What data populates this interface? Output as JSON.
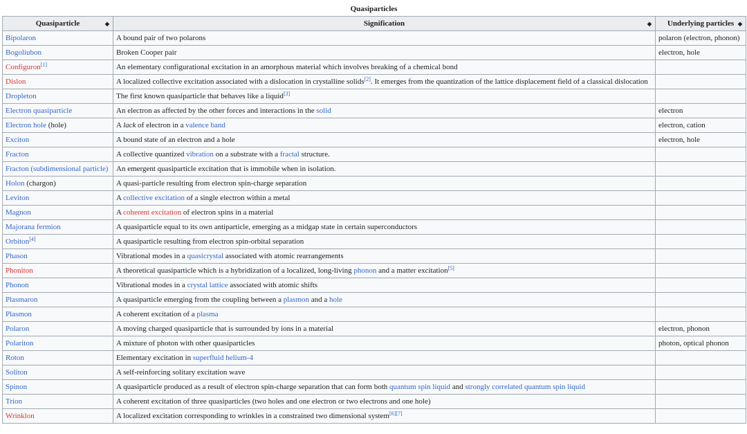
{
  "table": {
    "caption": "Quasiparticles",
    "headers": [
      "Quasiparticle",
      "Signification",
      "Underlying particles"
    ],
    "sort_icon": "sort-arrows-icon",
    "colors": {
      "link": "#3366cc",
      "redlink": "#dd3333",
      "border": "#a2a9b1",
      "header_bg": "#eaecf0"
    },
    "rows": [
      {
        "name": [
          {
            "t": "Bipolaron",
            "k": "link"
          }
        ],
        "sig": [
          {
            "t": "A bound pair of two polarons"
          }
        ],
        "under": "polaron (electron, phonon)"
      },
      {
        "name": [
          {
            "t": "Bogoliubon",
            "k": "link"
          }
        ],
        "sig": [
          {
            "t": "Broken Cooper pair"
          }
        ],
        "under": "electron, hole"
      },
      {
        "name": [
          {
            "t": "Configuron",
            "k": "new"
          },
          {
            "t": "[1]",
            "k": "sup"
          }
        ],
        "sig": [
          {
            "t": "An elementary configurational excitation in an amorphous material which involves breaking of a chemical bond"
          }
        ],
        "under": ""
      },
      {
        "name": [
          {
            "t": "Dislon",
            "k": "new"
          }
        ],
        "sig": [
          {
            "t": "A localized collective excitation associated with a dislocation in crystalline solids"
          },
          {
            "t": "[2]",
            "k": "sup"
          },
          {
            "t": ". It emerges from the quantization of the lattice displacement field of a classical dislocation"
          }
        ],
        "under": ""
      },
      {
        "name": [
          {
            "t": "Dropleton",
            "k": "link"
          }
        ],
        "sig": [
          {
            "t": "The first known quasiparticle that behaves like a liquid"
          },
          {
            "t": "[3]",
            "k": "sup"
          }
        ],
        "under": ""
      },
      {
        "name": [
          {
            "t": "Electron quasiparticle",
            "k": "link"
          }
        ],
        "sig": [
          {
            "t": "An electron as affected by the other forces and interactions in the "
          },
          {
            "t": "solid",
            "k": "link"
          }
        ],
        "under": "electron"
      },
      {
        "name": [
          {
            "t": "Electron hole",
            "k": "link"
          },
          {
            "t": " (hole)"
          }
        ],
        "sig": [
          {
            "t": "A "
          },
          {
            "t": "lack",
            "k": "i"
          },
          {
            "t": " of electron in a "
          },
          {
            "t": "valence band",
            "k": "link"
          }
        ],
        "under": "electron, cation"
      },
      {
        "name": [
          {
            "t": "Exciton",
            "k": "link"
          }
        ],
        "sig": [
          {
            "t": "A bound state of an electron and a hole"
          }
        ],
        "under": "electron, hole"
      },
      {
        "name": [
          {
            "t": "Fracton",
            "k": "link"
          }
        ],
        "sig": [
          {
            "t": "A collective quantized "
          },
          {
            "t": "vibration",
            "k": "link"
          },
          {
            "t": " on a substrate with a "
          },
          {
            "t": "fractal",
            "k": "link"
          },
          {
            "t": " structure."
          }
        ],
        "under": ""
      },
      {
        "name": [
          {
            "t": "Fracton (subdimensional particle)",
            "k": "link"
          }
        ],
        "sig": [
          {
            "t": "An emergent quasiparticle excitation that is immobile when in isolation."
          }
        ],
        "under": ""
      },
      {
        "name": [
          {
            "t": "Holon",
            "k": "link"
          },
          {
            "t": " (chargon)"
          }
        ],
        "sig": [
          {
            "t": "A quasi-particle resulting from electron spin-charge separation"
          }
        ],
        "under": ""
      },
      {
        "name": [
          {
            "t": "Leviton",
            "k": "link"
          }
        ],
        "sig": [
          {
            "t": "A "
          },
          {
            "t": "collective excitation",
            "k": "link"
          },
          {
            "t": " of a single electron within a metal"
          }
        ],
        "under": ""
      },
      {
        "name": [
          {
            "t": "Magnon",
            "k": "link"
          }
        ],
        "sig": [
          {
            "t": "A "
          },
          {
            "t": "coherent excitation",
            "k": "new"
          },
          {
            "t": " of electron spins in a material"
          }
        ],
        "under": ""
      },
      {
        "name": [
          {
            "t": "Majorana fermion",
            "k": "link"
          }
        ],
        "sig": [
          {
            "t": "A quasiparticle equal to its own antiparticle, emerging as a midgap state in certain superconductors"
          }
        ],
        "under": ""
      },
      {
        "name": [
          {
            "t": "Orbiton",
            "k": "link"
          },
          {
            "t": "[4]",
            "k": "sup"
          }
        ],
        "sig": [
          {
            "t": "A quasiparticle resulting from electron spin-orbital separation"
          }
        ],
        "under": ""
      },
      {
        "name": [
          {
            "t": "Phason",
            "k": "link"
          }
        ],
        "sig": [
          {
            "t": "Vibrational modes in a "
          },
          {
            "t": "quasicrystal",
            "k": "link"
          },
          {
            "t": " associated with atomic rearrangements"
          }
        ],
        "under": ""
      },
      {
        "name": [
          {
            "t": "Phoniton",
            "k": "new"
          }
        ],
        "sig": [
          {
            "t": "A theoretical quasiparticle which is a hybridization of a localized, long-living "
          },
          {
            "t": "phonon",
            "k": "link"
          },
          {
            "t": " and a matter excitation"
          },
          {
            "t": "[5]",
            "k": "sup"
          }
        ],
        "under": ""
      },
      {
        "name": [
          {
            "t": "Phonon",
            "k": "link"
          }
        ],
        "sig": [
          {
            "t": "Vibrational modes in a "
          },
          {
            "t": "crystal lattice",
            "k": "link"
          },
          {
            "t": " associated with atomic shifts"
          }
        ],
        "under": ""
      },
      {
        "name": [
          {
            "t": "Plasmaron",
            "k": "link"
          }
        ],
        "sig": [
          {
            "t": "A quasiparticle emerging from the coupling between a "
          },
          {
            "t": "plasmon",
            "k": "link"
          },
          {
            "t": " and a "
          },
          {
            "t": "hole",
            "k": "link"
          }
        ],
        "under": ""
      },
      {
        "name": [
          {
            "t": "Plasmon",
            "k": "link"
          }
        ],
        "sig": [
          {
            "t": "A coherent excitation of a "
          },
          {
            "t": "plasma",
            "k": "link"
          }
        ],
        "under": ""
      },
      {
        "name": [
          {
            "t": "Polaron",
            "k": "link"
          }
        ],
        "sig": [
          {
            "t": "A moving charged quasiparticle that is surrounded by ions in a material"
          }
        ],
        "under": "electron, phonon"
      },
      {
        "name": [
          {
            "t": "Polariton",
            "k": "link"
          }
        ],
        "sig": [
          {
            "t": "A mixture of photon with other quasiparticles"
          }
        ],
        "under": "photon, optical phonon"
      },
      {
        "name": [
          {
            "t": "Roton",
            "k": "link"
          }
        ],
        "sig": [
          {
            "t": "Elementary excitation in "
          },
          {
            "t": "superfluid helium-4",
            "k": "link"
          }
        ],
        "under": ""
      },
      {
        "name": [
          {
            "t": "Soliton",
            "k": "link"
          }
        ],
        "sig": [
          {
            "t": "A self-reinforcing solitary excitation wave"
          }
        ],
        "under": ""
      },
      {
        "name": [
          {
            "t": "Spinon",
            "k": "link"
          }
        ],
        "sig": [
          {
            "t": "A quasiparticle produced as a result of electron spin-charge separation that can form both "
          },
          {
            "t": "quantum spin liquid",
            "k": "link"
          },
          {
            "t": " and "
          },
          {
            "t": "strongly correlated quantum spin liquid",
            "k": "link"
          }
        ],
        "under": ""
      },
      {
        "name": [
          {
            "t": "Trion",
            "k": "link"
          }
        ],
        "sig": [
          {
            "t": "A coherent excitation of three quasiparticles (two holes and one electron or two electrons and one hole)"
          }
        ],
        "under": ""
      },
      {
        "name": [
          {
            "t": "Wrinklon",
            "k": "new"
          }
        ],
        "sig": [
          {
            "t": "A localized excitation corresponding to wrinkles in a constrained two dimensional system"
          },
          {
            "t": "[6]",
            "k": "sup"
          },
          {
            "t": "[7]",
            "k": "sup"
          }
        ],
        "under": ""
      }
    ]
  }
}
